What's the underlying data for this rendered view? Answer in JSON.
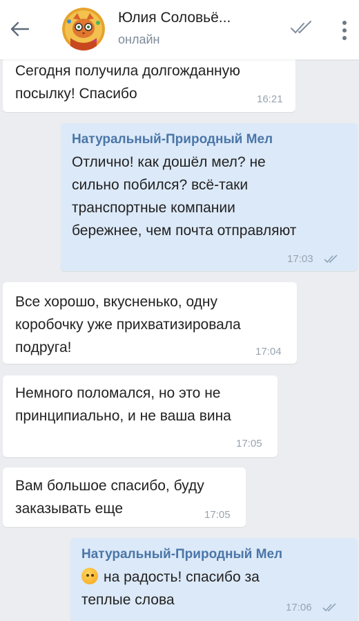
{
  "header": {
    "contact_name": "Юлия Соловьё...",
    "status": "онлайн"
  },
  "colors": {
    "incoming_bubble": "#ffffff",
    "outgoing_bubble": "#dce9f8",
    "sender_name": "#4a76a8",
    "background": "#ebedf0"
  },
  "messages": [
    {
      "direction": "in",
      "text": "Сегодня получила долгожданную\nпосылку! Спасибо",
      "time": "16:21"
    },
    {
      "direction": "out",
      "sender": "Натуральный-Природный Мел",
      "text": "Отлично! как дошёл мел? не\nсильно побился? всё-таки\nтранспортные компании\nбережнее, чем почта отправляют",
      "time": "17:03"
    },
    {
      "direction": "in",
      "text": "Все хорошо, вкусненько, одну\nкоробочку уже прихватизировала\nподруга!",
      "time": "17:04"
    },
    {
      "direction": "in",
      "text": "Немного поломался, но это не\nпринципиально, и не ваша вина",
      "time": "17:05"
    },
    {
      "direction": "in",
      "text": "Вам большое спасибо, буду\nзаказывать еще",
      "time": "17:05"
    },
    {
      "direction": "out",
      "sender": "Натуральный-Природный Мел",
      "emoji": "upside-down-face-emoji",
      "text": "на радость! спасибо за\nтеплые слова",
      "time": "17:06"
    }
  ]
}
